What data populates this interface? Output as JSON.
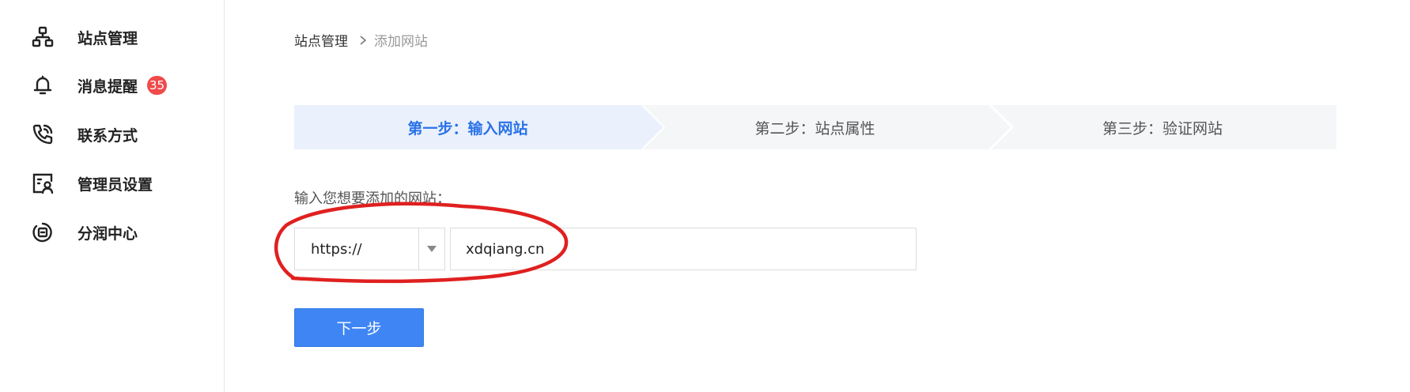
{
  "sidebar": {
    "items": [
      {
        "label": "站点管理",
        "icon": "sitemap-icon"
      },
      {
        "label": "消息提醒",
        "icon": "bell-icon",
        "badge": "35"
      },
      {
        "label": "联系方式",
        "icon": "phone-icon"
      },
      {
        "label": "管理员设置",
        "icon": "admin-user-icon"
      },
      {
        "label": "分润中心",
        "icon": "revenue-share-icon"
      }
    ]
  },
  "breadcrumb": {
    "root": "站点管理",
    "current": "添加网站"
  },
  "steps": [
    {
      "label": "第一步：输入网站",
      "active": true
    },
    {
      "label": "第二步：站点属性",
      "active": false
    },
    {
      "label": "第三步：验证网站",
      "active": false
    }
  ],
  "form": {
    "prompt": "输入您想要添加的网站：",
    "protocol": "https://",
    "domain": "xdqiang.cn"
  },
  "next_button": "下一步",
  "colors": {
    "accent": "#3f86f4",
    "active_step_text": "#2b72e8",
    "active_step_bg": "#eaf1fc",
    "inactive_step_bg": "#f5f6f8",
    "badge": "#f04a4a",
    "annotation_red": "#e02020"
  }
}
